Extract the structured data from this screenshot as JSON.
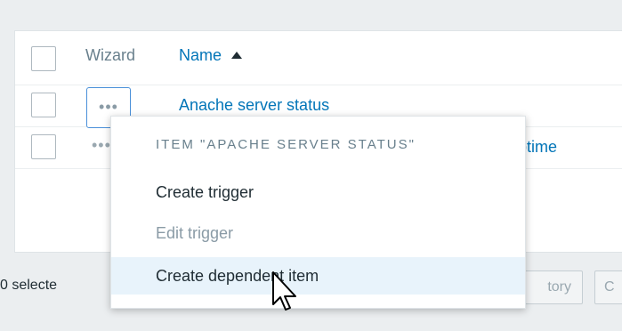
{
  "table": {
    "header": {
      "wizard_label": "Wizard",
      "name_label": "Name"
    },
    "rows": [
      {
        "wizard": "•••",
        "name": "Anache server status"
      },
      {
        "wizard": "•••",
        "name": "r uptime"
      }
    ]
  },
  "footer": {
    "selected_text": "0 selecte",
    "history_label": "tory",
    "next_label": "C"
  },
  "context_menu": {
    "header": "ITEM \"APACHE SERVER STATUS\"",
    "items": [
      {
        "label": "Create trigger",
        "enabled": true
      },
      {
        "label": "Edit trigger",
        "enabled": false
      },
      {
        "label": "Create dependent item",
        "enabled": true,
        "hovered": true
      }
    ]
  },
  "colors": {
    "link": "#0275b8",
    "hover_background": "#e8f3fb",
    "page_background": "#ebeef0"
  },
  "icons": {
    "sort": "sort-ascending-icon",
    "cursor": "mouse-pointer-icon"
  }
}
